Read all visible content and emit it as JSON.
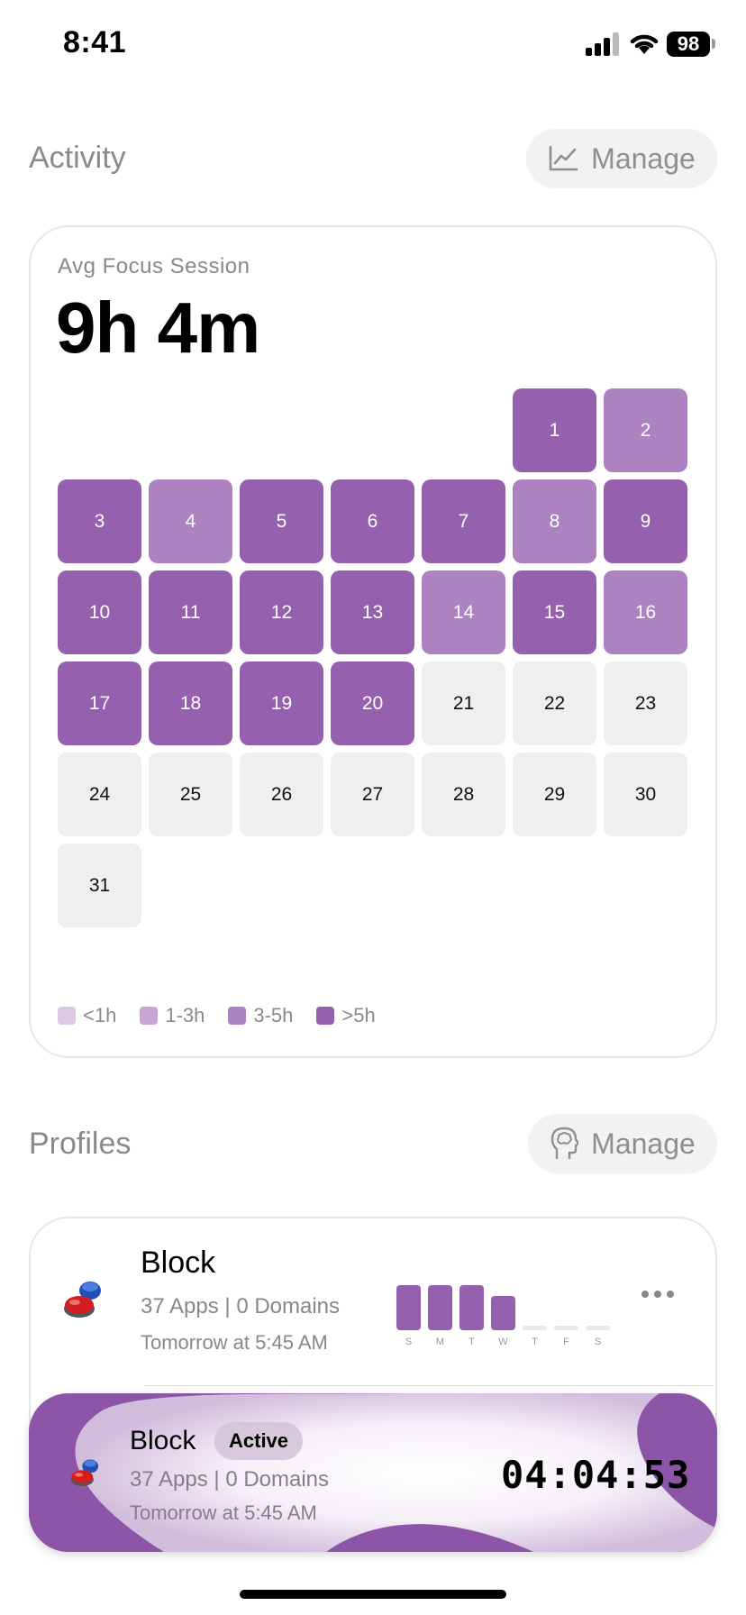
{
  "status_bar": {
    "time": "8:41",
    "battery": "98",
    "icons": [
      "cellular-signal-icon",
      "wifi-icon",
      "battery-icon"
    ]
  },
  "activity": {
    "title": "Activity",
    "manage_label": "Manage",
    "manage_icon": "trend-chart-icon",
    "avg_label": "Avg Focus Session",
    "avg_value": "9h 4m",
    "calendar_days": [
      {
        "day": "1",
        "level": "dark"
      },
      {
        "day": "2",
        "level": "mid"
      },
      {
        "day": "3",
        "level": "dark"
      },
      {
        "day": "4",
        "level": "mid"
      },
      {
        "day": "5",
        "level": "dark"
      },
      {
        "day": "6",
        "level": "dark"
      },
      {
        "day": "7",
        "level": "dark"
      },
      {
        "day": "8",
        "level": "mid"
      },
      {
        "day": "9",
        "level": "dark"
      },
      {
        "day": "10",
        "level": "dark"
      },
      {
        "day": "11",
        "level": "dark"
      },
      {
        "day": "12",
        "level": "dark"
      },
      {
        "day": "13",
        "level": "dark"
      },
      {
        "day": "14",
        "level": "mid"
      },
      {
        "day": "15",
        "level": "dark"
      },
      {
        "day": "16",
        "level": "mid"
      },
      {
        "day": "17",
        "level": "dark"
      },
      {
        "day": "18",
        "level": "dark"
      },
      {
        "day": "19",
        "level": "dark"
      },
      {
        "day": "20",
        "level": "dark"
      },
      {
        "day": "21",
        "level": "none"
      },
      {
        "day": "22",
        "level": "none"
      },
      {
        "day": "23",
        "level": "none"
      },
      {
        "day": "24",
        "level": "none"
      },
      {
        "day": "25",
        "level": "none"
      },
      {
        "day": "26",
        "level": "none"
      },
      {
        "day": "27",
        "level": "none"
      },
      {
        "day": "28",
        "level": "none"
      },
      {
        "day": "29",
        "level": "none"
      },
      {
        "day": "30",
        "level": "none"
      },
      {
        "day": "31",
        "level": "none"
      }
    ],
    "legend": [
      {
        "label": "<1h",
        "color": "#ddc8e6"
      },
      {
        "label": "1-3h",
        "color": "#c7a6d5"
      },
      {
        "label": "3-5h",
        "color": "#ad82c0"
      },
      {
        "label": ">5h",
        "color": "#9560ae"
      }
    ],
    "colors": {
      "dark": "#9560ae",
      "mid": "#ad82c0",
      "none": "#efefef"
    }
  },
  "profiles": {
    "title": "Profiles",
    "manage_label": "Manage",
    "manage_icon": "brain-head-icon",
    "items": [
      {
        "name": "Block",
        "details": "37 Apps | 0 Domains",
        "schedule": "Tomorrow at 5:45 AM",
        "icon": "buzzer-button-icon",
        "week_labels": [
          "S",
          "M",
          "T",
          "W",
          "T",
          "F",
          "S"
        ],
        "week_usage": [
          1.0,
          1.0,
          1.0,
          0.75,
          0.1,
          0.1,
          0.1
        ]
      }
    ]
  },
  "active_session": {
    "name": "Block",
    "status": "Active",
    "details": "37 Apps | 0 Domains",
    "schedule": "Tomorrow at 5:45 AM",
    "timer": "04:04:53",
    "icon": "buzzer-button-icon"
  }
}
